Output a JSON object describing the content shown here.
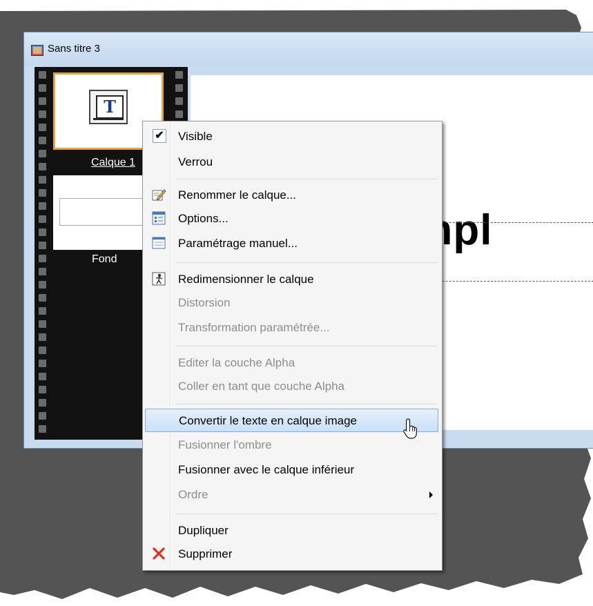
{
  "window": {
    "title": "Sans titre 3"
  },
  "layers": [
    {
      "name": "Calque 1",
      "type": "text"
    },
    {
      "name": "Fond",
      "type": "background"
    }
  ],
  "canvas": {
    "visible_text": "impl"
  },
  "context_menu": {
    "items": [
      {
        "label": "Visible",
        "checked": true,
        "icon": "check-icon",
        "enabled": true
      },
      {
        "label": "Verrou",
        "enabled": true
      },
      {
        "label": "Renommer le calque...",
        "icon": "rename-icon",
        "enabled": true
      },
      {
        "label": "Options...",
        "icon": "options-icon",
        "enabled": true
      },
      {
        "label": "Paramétrage manuel...",
        "icon": "manual-settings-icon",
        "enabled": true
      },
      {
        "label": "Redimensionner le calque",
        "icon": "resize-icon",
        "enabled": true
      },
      {
        "label": "Distorsion",
        "enabled": false
      },
      {
        "label": "Transformation paramétrée...",
        "enabled": false
      },
      {
        "label": "Editer la couche Alpha",
        "enabled": false
      },
      {
        "label": "Coller en tant que couche Alpha",
        "enabled": false
      },
      {
        "label": "Convertir le texte en calque image",
        "enabled": true,
        "highlighted": true
      },
      {
        "label": "Fusionner l'ombre",
        "enabled": false
      },
      {
        "label": "Fusionner avec le calque inférieur",
        "enabled": true
      },
      {
        "label": "Ordre",
        "enabled": false,
        "submenu": true
      },
      {
        "label": "Dupliquer",
        "enabled": true
      },
      {
        "label": "Supprimer",
        "icon": "delete-icon",
        "enabled": true
      }
    ]
  },
  "colors": {
    "highlight": "#c9e0f7",
    "disabled_text": "#8d8d8d",
    "thumb_border": "#e0a54a",
    "filmstrip": "#121212"
  }
}
